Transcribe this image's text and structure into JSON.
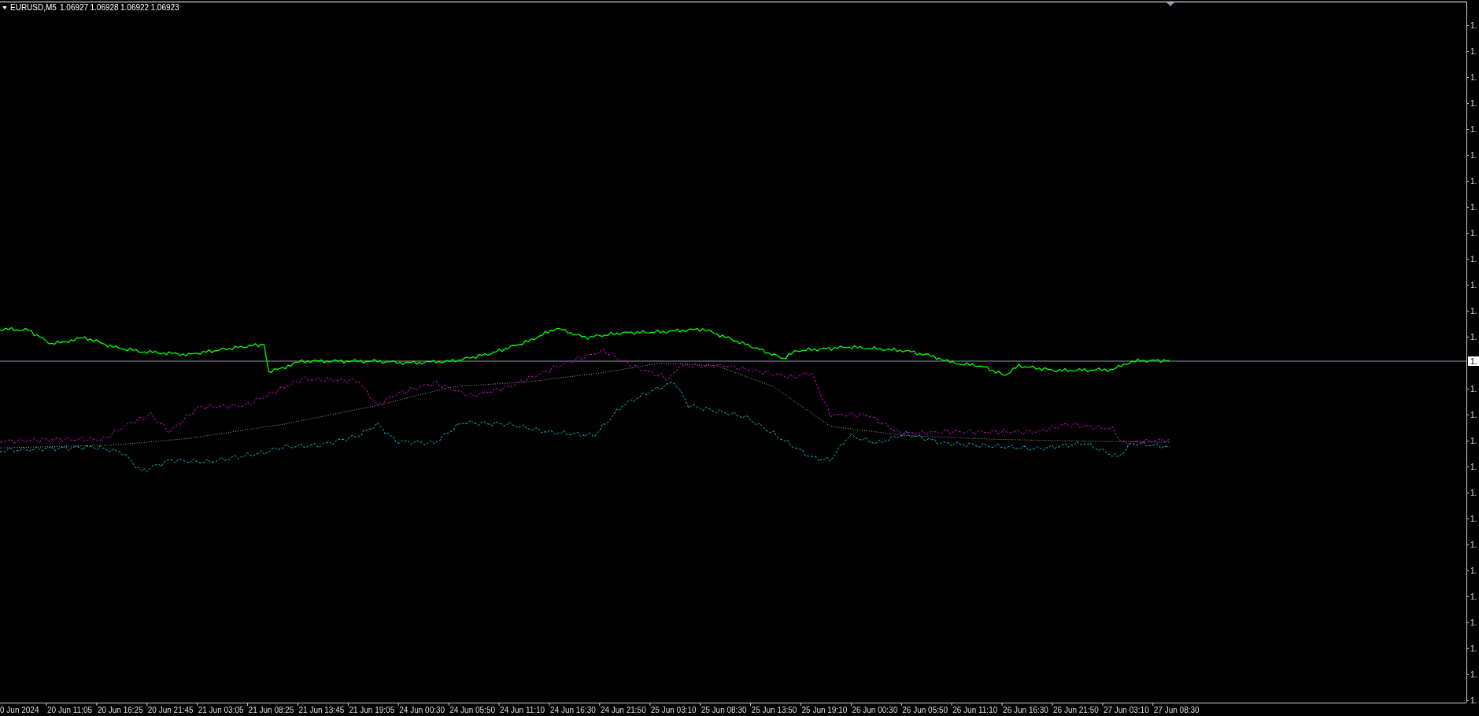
{
  "chart_header": {
    "symbol": "EURUSD,M5",
    "values": [
      "1.06927",
      "1.06928",
      "1.06922",
      "1.06923"
    ]
  },
  "price_axis": {
    "labels": [
      "1.",
      "1.",
      "1.",
      "1.",
      "1.",
      "1.",
      "1.",
      "1.",
      "1.",
      "1.",
      "1.",
      "1.",
      "1.",
      "1.",
      "1.",
      "1.",
      "1.",
      "1.",
      "1.",
      "1.",
      "1.",
      "1.",
      "1.",
      "1.",
      "1.",
      "1."
    ],
    "current_price": "1."
  },
  "time_axis": {
    "labels": [
      "0 Jun 2024",
      "20 Jun 11:05",
      "20 Jun 16:25",
      "20 Jun 21:45",
      "21 Jun 03:05",
      "21 Jun 08:25",
      "21 Jun 13:45",
      "21 Jun 19:05",
      "24 Jun 00:30",
      "24 Jun 05:50",
      "24 Jun 11:10",
      "24 Jun 16:30",
      "24 Jun 21:50",
      "25 Jun 03:10",
      "25 Jun 08:30",
      "25 Jun 13:50",
      "25 Jun 19:10",
      "26 Jun 00:30",
      "26 Jun 05:50",
      "26 Jun 11:10",
      "26 Jun 16:30",
      "26 Jun 21:50",
      "27 Jun 03:10",
      "27 Jun 08:30"
    ]
  }
}
